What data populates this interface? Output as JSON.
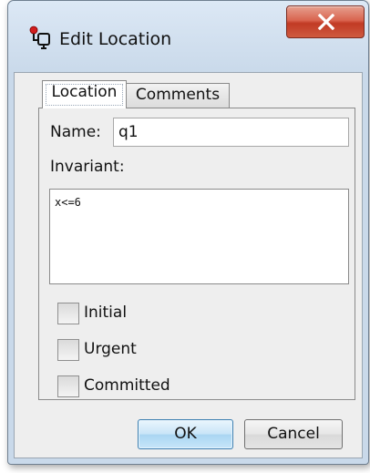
{
  "window": {
    "title": "Edit Location"
  },
  "tabs": [
    {
      "label": "Location",
      "selected": true
    },
    {
      "label": "Comments",
      "selected": false
    }
  ],
  "form": {
    "name_label": "Name:",
    "name_value": "q1",
    "invariant_label": "Invariant:",
    "invariant_value": "x<=6",
    "checkboxes": [
      {
        "label": "Initial",
        "checked": false
      },
      {
        "label": "Urgent",
        "checked": false
      },
      {
        "label": "Committed",
        "checked": false
      }
    ]
  },
  "buttons": {
    "ok_label": "OK",
    "cancel_label": "Cancel"
  },
  "colors": {
    "close_button": "#c13a24",
    "ok_button_border": "#3c7fb1"
  },
  "icons": {
    "app": "edit-location-icon",
    "close": "close-icon"
  }
}
